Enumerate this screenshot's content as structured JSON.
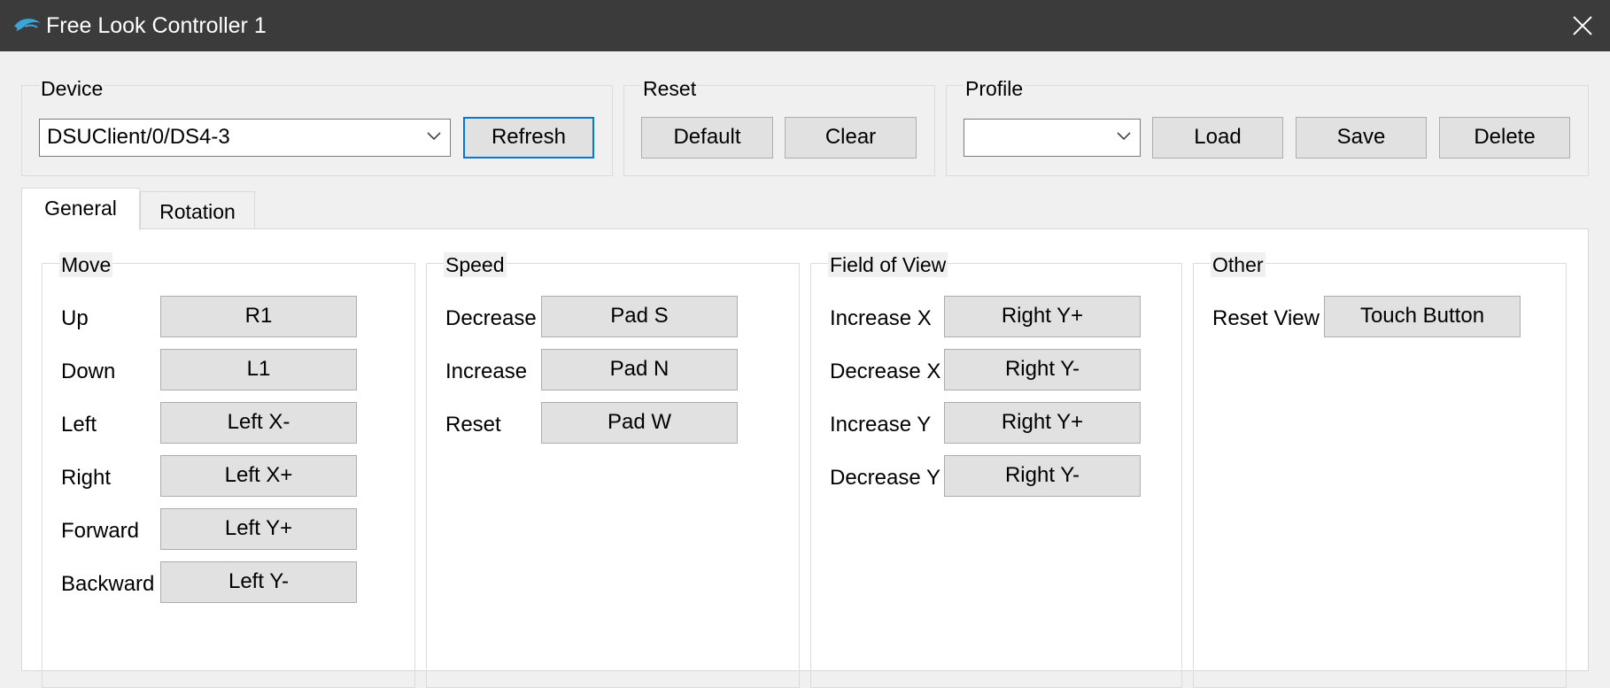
{
  "window": {
    "title": "Free Look Controller 1",
    "app_icon": "dolphin-logo-icon",
    "close_icon": "close-icon"
  },
  "device": {
    "label": "Device",
    "selected": "DSUClient/0/DS4-3",
    "refresh_label": "Refresh"
  },
  "reset": {
    "label": "Reset",
    "default_label": "Default",
    "clear_label": "Clear"
  },
  "profile": {
    "label": "Profile",
    "selected": "",
    "load_label": "Load",
    "save_label": "Save",
    "delete_label": "Delete"
  },
  "tabs": [
    {
      "label": "General",
      "active": true
    },
    {
      "label": "Rotation",
      "active": false
    }
  ],
  "groups": {
    "move": {
      "label": "Move",
      "rows": [
        {
          "label": "Up",
          "binding": "R1"
        },
        {
          "label": "Down",
          "binding": "L1"
        },
        {
          "label": "Left",
          "binding": "Left X-"
        },
        {
          "label": "Right",
          "binding": "Left X+"
        },
        {
          "label": "Forward",
          "binding": "Left Y+"
        },
        {
          "label": "Backward",
          "binding": "Left Y-"
        }
      ]
    },
    "speed": {
      "label": "Speed",
      "rows": [
        {
          "label": "Decrease",
          "binding": "Pad S"
        },
        {
          "label": "Increase",
          "binding": "Pad N"
        },
        {
          "label": "Reset",
          "binding": "Pad W"
        }
      ]
    },
    "fov": {
      "label": "Field of View",
      "rows": [
        {
          "label": "Increase X",
          "binding": "Right Y+"
        },
        {
          "label": "Decrease X",
          "binding": "Right Y-"
        },
        {
          "label": "Increase Y",
          "binding": "Right Y+"
        },
        {
          "label": "Decrease Y",
          "binding": "Right Y-"
        }
      ]
    },
    "other": {
      "label": "Other",
      "rows": [
        {
          "label": "Reset View",
          "binding": "Touch Button"
        }
      ]
    }
  },
  "colors": {
    "titlebar": "#3b3b3b",
    "focus_accent": "#0078d7",
    "dolphin": "#3aa6d8"
  }
}
